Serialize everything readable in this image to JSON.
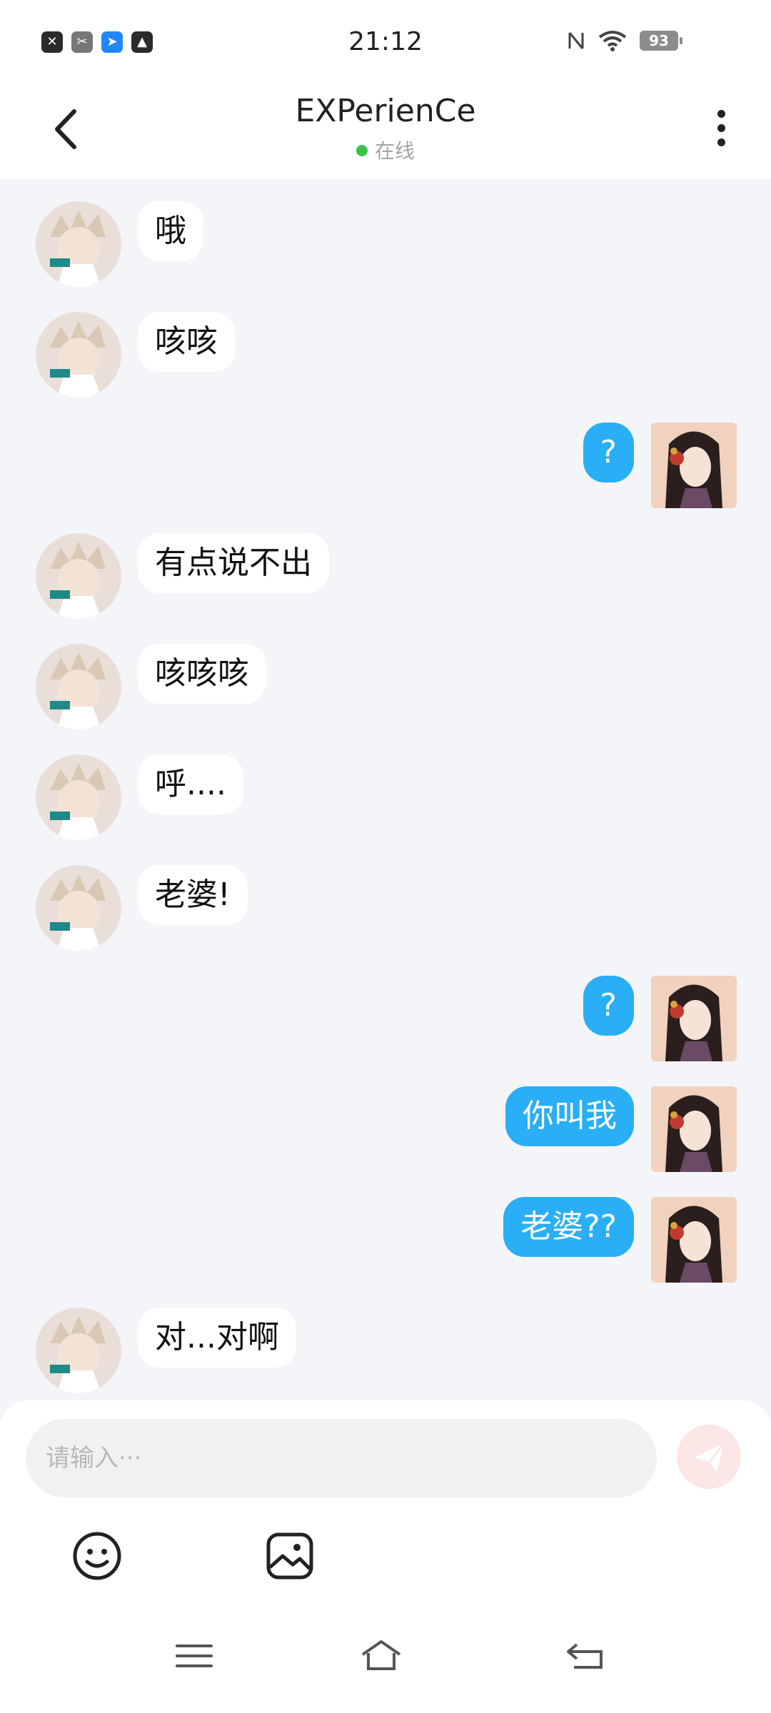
{
  "status_bar": {
    "time": "21:12",
    "battery": "93",
    "left_icons": [
      "close-app-icon",
      "scissors-app-icon",
      "blue-app-icon",
      "photo-app-icon"
    ],
    "right_icons": [
      "nfc-icon",
      "wifi-icon",
      "battery-icon"
    ]
  },
  "header": {
    "title": "EXPerienCe",
    "status": "在线",
    "status_color": "#3cc24b"
  },
  "messages": [
    {
      "from": "other",
      "text": "哦"
    },
    {
      "from": "other",
      "text": "咳咳"
    },
    {
      "from": "me",
      "text": "?"
    },
    {
      "from": "other",
      "text": "有点说不出"
    },
    {
      "from": "other",
      "text": "咳咳咳"
    },
    {
      "from": "other",
      "text": "呼...."
    },
    {
      "from": "other",
      "text": "老婆!"
    },
    {
      "from": "me",
      "text": "?"
    },
    {
      "from": "me",
      "text": "你叫我"
    },
    {
      "from": "me",
      "text": "老婆??"
    },
    {
      "from": "other",
      "text": "对...对啊"
    }
  ],
  "composer": {
    "placeholder": "请输入···",
    "send_icon": "send-icon",
    "emoji_icon": "emoji-icon",
    "image_icon": "image-icon"
  },
  "colors": {
    "my_bubble": "#2aaef5",
    "other_bubble": "#ffffff",
    "chat_background": "#f3f5f8"
  }
}
